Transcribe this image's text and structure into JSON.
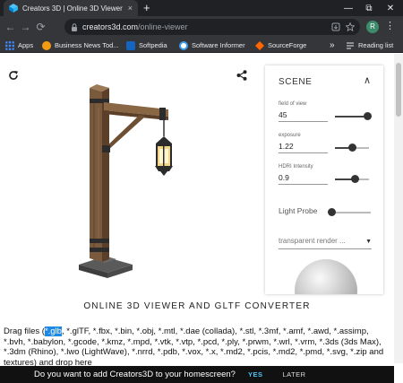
{
  "tab": {
    "title": "Creators 3D | Online 3D Viewer",
    "close_icon": "×",
    "new_tab_icon": "+"
  },
  "window": {
    "minimize": "—",
    "restore": "⧉",
    "close": "✕"
  },
  "toolbar": {
    "back": "←",
    "forward": "→",
    "reload": "⟳",
    "url_host": "creators3d.com",
    "url_path": "/online-viewer",
    "profile_initial": "R",
    "menu": "⋮"
  },
  "bookmarks": [
    {
      "label": "Apps",
      "icon": "apps-icon",
      "color": "#4285f4"
    },
    {
      "label": "Business News Tod...",
      "icon": "bsn-icon",
      "color": "#f39c12"
    },
    {
      "label": "Softpedia",
      "icon": "softpedia-icon",
      "color": "#1565c0"
    },
    {
      "label": "Software Informer",
      "icon": "software-informer-icon",
      "color": "#ffffff"
    },
    {
      "label": "SourceForge",
      "icon": "sourceforge-icon",
      "color": "#ff6600"
    },
    {
      "label": "»",
      "icon": "more-icon",
      "color": ""
    },
    {
      "label": "Reading list",
      "icon": "reading-list-icon",
      "color": "#e8eaed"
    }
  ],
  "scene": {
    "title": "SCENE",
    "fov": {
      "label": "field of view",
      "value": "45",
      "level": 0.95
    },
    "exposure": {
      "label": "exposure",
      "value": "1.22",
      "level": 0.5
    },
    "hdri": {
      "label": "HDRI Intensity",
      "value": "0.9",
      "level": 0.6
    },
    "light_probe": {
      "label": "Light Probe",
      "level": 0.0
    },
    "render_select": "transparent render ..."
  },
  "heading": "ONLINE 3D VIEWER AND GLTF CONVERTER",
  "drag": {
    "prefix": "Drag files (",
    "highlight": "*.glb",
    "rest": ", *.glTF, *.fbx, *.bin, *.obj, *.mtl, *.dae (collada), *.stl, *.3mf, *.amf, *.awd, *.assimp, *.bvh, *.babylon, *.gcode, *.kmz, *.mpd, *.vtk, *.vtp, *.pcd, *.ply, *.prwm, *.wrl, *.vrm, *.3ds (3ds Max), *.3dm (Rhino), *.lwo (LightWave), *.nrrd, *.pdb, *.vox, *.x, *.md2, *.pcis, *.md2, *.pmd, *.svg, *.zip and textures) and drop here"
  },
  "install": {
    "text": "Do you want to add Creators3D to your homescreen?",
    "yes": "YES",
    "later": "LATER"
  },
  "colors": {
    "accent": "#1e88e5",
    "chrome_dark": "#202124",
    "chrome_mid": "#35363a"
  }
}
